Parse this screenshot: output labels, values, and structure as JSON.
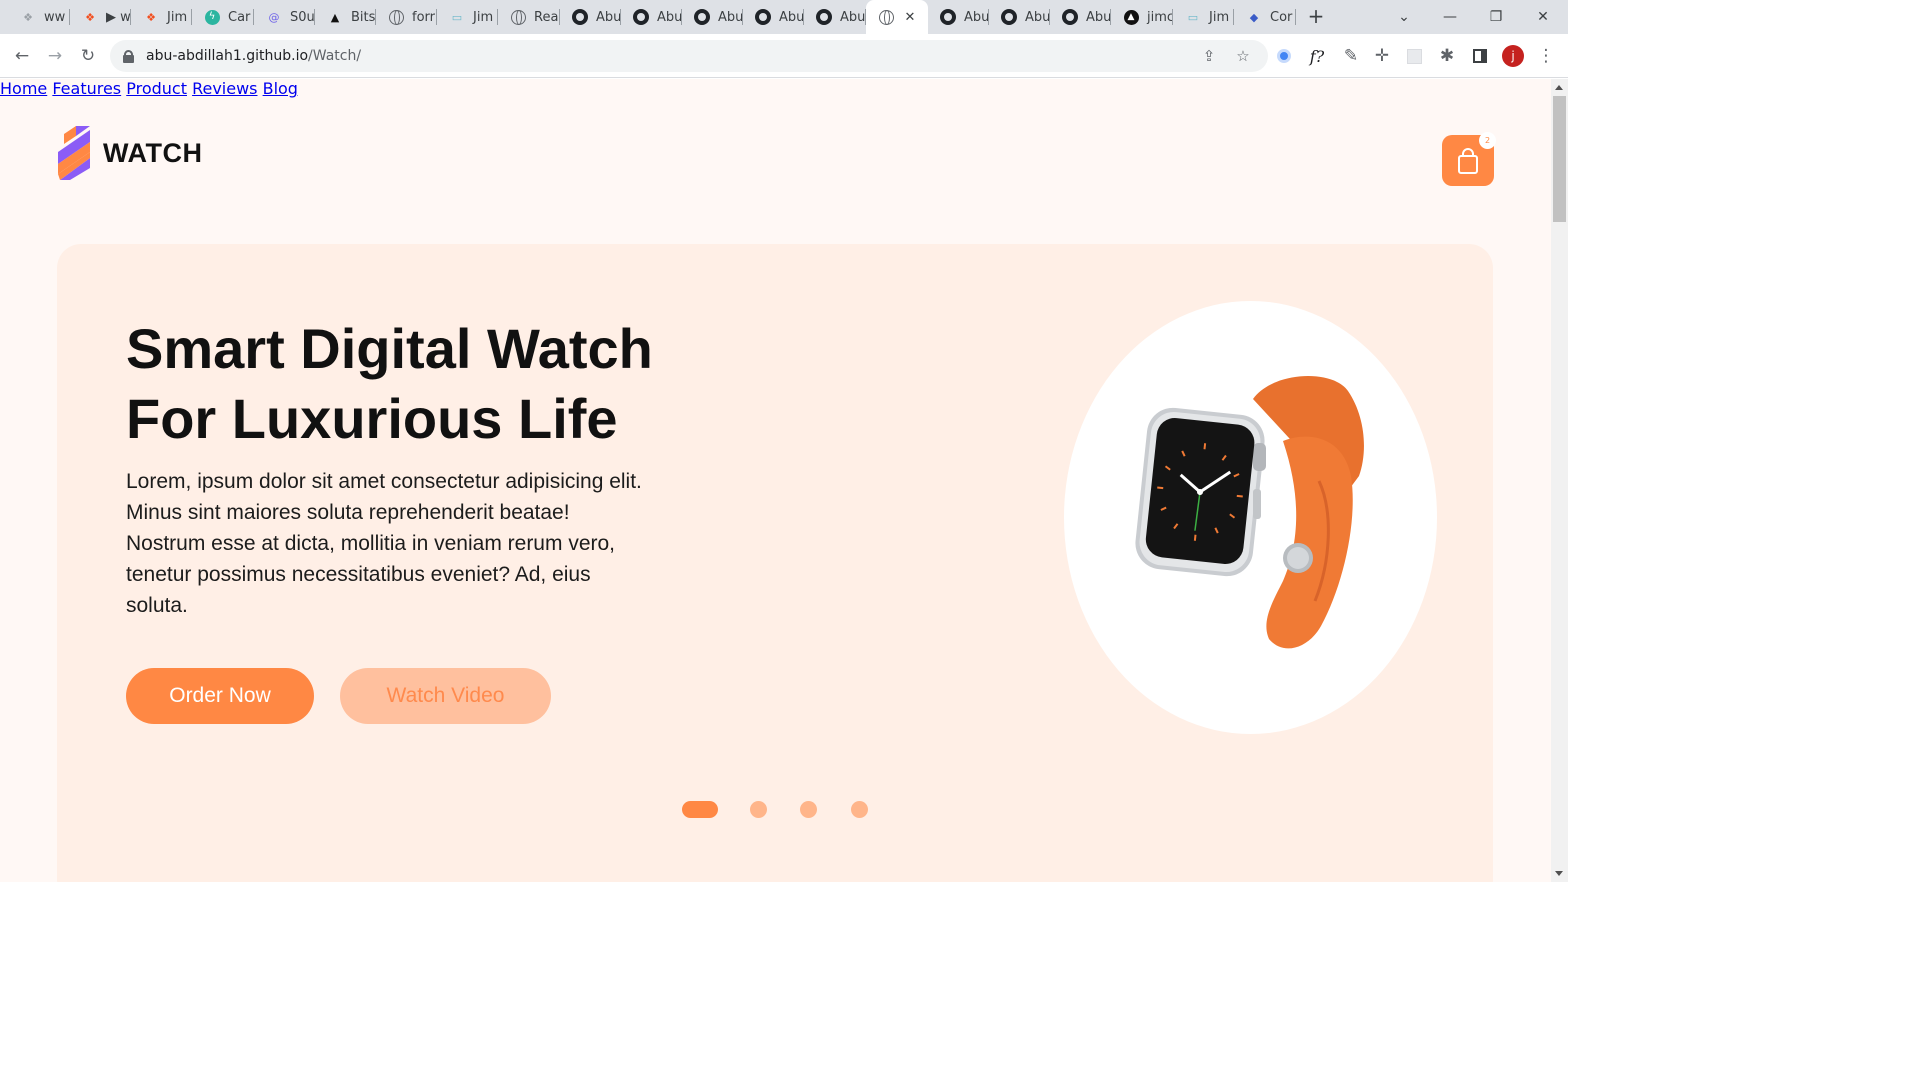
{
  "browser": {
    "tabs": [
      {
        "title": "ww",
        "icon": "figma-grey-icon"
      },
      {
        "title": "▶ w",
        "icon": "figma-icon"
      },
      {
        "title": "Jim",
        "icon": "figma-icon"
      },
      {
        "title": "Car",
        "icon": "bolt-icon"
      },
      {
        "title": "S0u",
        "icon": "spiral-icon"
      },
      {
        "title": "Bits",
        "icon": "triangle-icon"
      },
      {
        "title": "forr",
        "icon": "globe-icon"
      },
      {
        "title": "Jim",
        "icon": "laptop-icon"
      },
      {
        "title": "Rea",
        "icon": "globe-icon"
      },
      {
        "title": "Abu",
        "icon": "github-icon"
      },
      {
        "title": "Abu",
        "icon": "github-icon"
      },
      {
        "title": "Abu",
        "icon": "github-icon"
      },
      {
        "title": "Abu",
        "icon": "github-icon"
      },
      {
        "title": "Abu",
        "icon": "github-icon"
      },
      {
        "title": "",
        "icon": "globe-icon",
        "active": true
      },
      {
        "title": "Abu",
        "icon": "github-icon"
      },
      {
        "title": "Abu",
        "icon": "github-icon"
      },
      {
        "title": "Abu",
        "icon": "github-icon"
      },
      {
        "title": "jimc",
        "icon": "circle-a-icon"
      },
      {
        "title": "Jim",
        "icon": "laptop-icon"
      },
      {
        "title": "Cor",
        "icon": "shield-icon"
      }
    ],
    "url_host": "abu-abdillah1.github.io",
    "url_path": "/Watch/",
    "profile_initial": "j",
    "extension_fx_label": "f?"
  },
  "site": {
    "logo_text": "WATCH",
    "nav": [
      "Home",
      "Features",
      "Product",
      "Reviews",
      "Blog"
    ],
    "cart_count": "2",
    "hero": {
      "title_line1": "Smart Digital Watch",
      "title_line2": "For Luxurious Life",
      "text": "Lorem, ipsum dolor sit amet consectetur adipisicing elit. Minus sint maiores soluta reprehenderit beatae! Nostrum esse at dicta, mollitia in veniam rerum vero, tenetur possimus necessitatibus eveniet? Ad, eius soluta.",
      "order_label": "Order Now",
      "video_label": "Watch Video"
    },
    "slider": {
      "count": 4,
      "active_index": 0
    },
    "colors": {
      "accent": "#ff8844",
      "accent_light": "#ffc09e",
      "hero_bg": "#ffefe6",
      "page_bg": "#fff8f5"
    }
  }
}
